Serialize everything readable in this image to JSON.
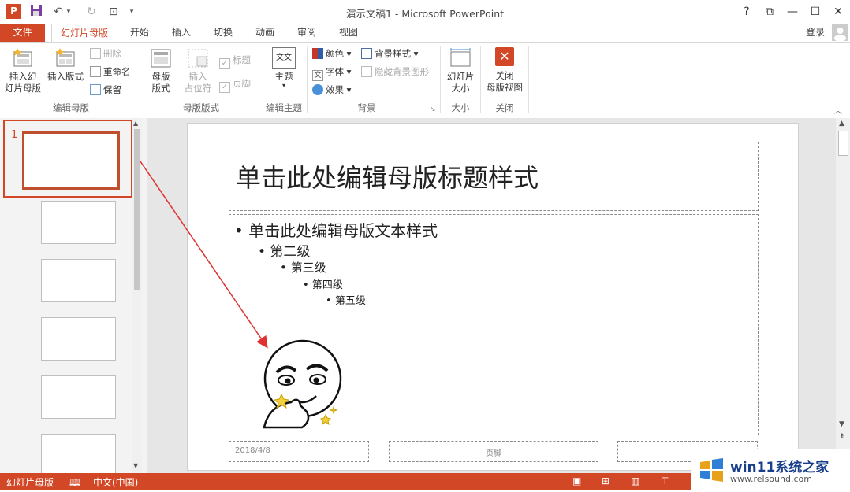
{
  "app": {
    "title": "演示文稿1 - Microsoft PowerPoint",
    "login": "登录",
    "help": "?",
    "ppt_logo": "P"
  },
  "tabs": [
    {
      "label": "文件"
    },
    {
      "label": "幻灯片母版"
    },
    {
      "label": "开始"
    },
    {
      "label": "插入"
    },
    {
      "label": "切换"
    },
    {
      "label": "动画"
    },
    {
      "label": "审阅"
    },
    {
      "label": "视图"
    }
  ],
  "ribbon": {
    "edit_master": {
      "label": "编辑母版",
      "insert_slide_master": "插入幻\n灯片母版",
      "insert_layout": "插入版式",
      "delete": "删除",
      "rename": "重命名",
      "preserve": "保留"
    },
    "master_layout": {
      "label": "母版版式",
      "master_layout_btn": "母版\n版式",
      "insert_placeholder": "插入\n占位符",
      "title_cb": "标题",
      "footer_cb": "页脚"
    },
    "edit_theme": {
      "label": "编辑主题",
      "themes": "主题",
      "theme_icon_text": "文文"
    },
    "background": {
      "label": "背景",
      "colors": "颜色",
      "fonts": "字体",
      "effects": "效果",
      "bg_styles": "背景样式",
      "hide_bg": "隐藏背景图形"
    },
    "size": {
      "label": "大小",
      "slide_size": "幻灯片\n大小"
    },
    "close": {
      "label": "关闭",
      "close_master": "关闭\n母版视图"
    }
  },
  "thumbnails": {
    "first_number": "1"
  },
  "slide": {
    "title": "单击此处编辑母版标题样式",
    "levels": [
      "单击此处编辑母版文本样式",
      "第二级",
      "第三级",
      "第四级",
      "第五级"
    ],
    "date": "2018/4/8",
    "footer": "页脚"
  },
  "status": {
    "mode": "幻灯片母版",
    "language": "中文(中国)"
  },
  "watermark": {
    "brand": "win11系统之家",
    "url": "www.relsound.com"
  },
  "colors": {
    "accent": "#d24726",
    "annotation": "#e03030"
  }
}
